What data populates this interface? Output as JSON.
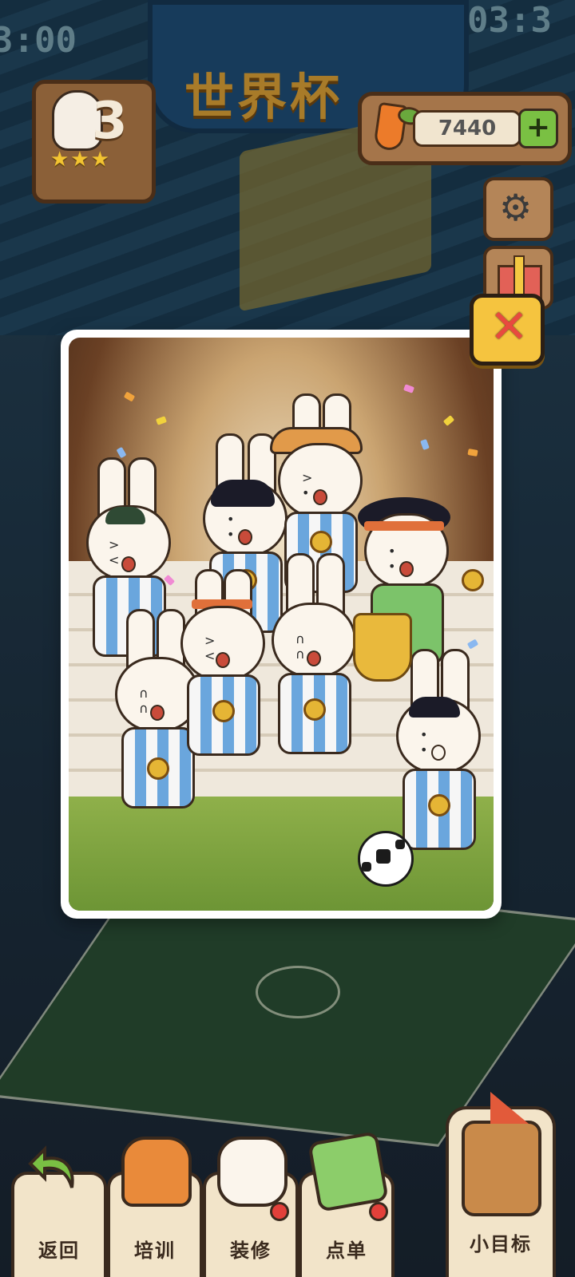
{
  "background": {
    "banner_title": "世界杯",
    "clock_left": "3:00",
    "clock_right": "03:3"
  },
  "level": {
    "number": "3",
    "stars": "★★★"
  },
  "currency": {
    "carrots": "7440",
    "add_symbol": "+"
  },
  "side_buttons": {
    "settings_icon": "⚙",
    "gift_icon": "gift-icon"
  },
  "modal": {
    "close_symbol": "✕"
  },
  "bottom_nav": {
    "back": "返回",
    "train": "培训",
    "decorate": "装修",
    "order": "点单",
    "goal": "小目标"
  },
  "colors": {
    "accent_yellow": "#f5c43f",
    "close_red": "#e84a3f",
    "wood": "#a5754a",
    "jersey_blue": "#6aa6dd",
    "plus_green": "#7ac043"
  }
}
